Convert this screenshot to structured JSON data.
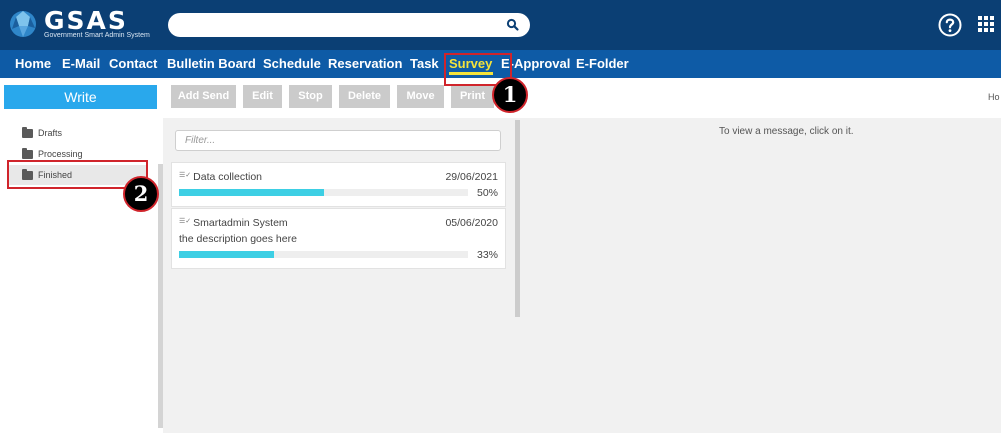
{
  "header": {
    "logo_text": "GSAS",
    "logo_subtitle": "Government Smart Admin System",
    "search_value": ""
  },
  "nav": {
    "items": [
      "Home",
      "E-Mail",
      "Contact",
      "Bulletin Board",
      "Schedule",
      "Reservation",
      "Task",
      "Survey",
      "E-Approval",
      "E-Folder"
    ],
    "active": "Survey"
  },
  "sidebar": {
    "write_label": "Write",
    "folders": [
      "Drafts",
      "Processing",
      "Finished"
    ],
    "selected": "Finished"
  },
  "toolbar": {
    "buttons": [
      "Add Send",
      "Edit",
      "Stop",
      "Delete",
      "Move",
      "Print"
    ],
    "breadcrumb": "Ho"
  },
  "list": {
    "filter_placeholder": "Filter...",
    "items": [
      {
        "title": "Data collection",
        "date": "29/06/2021",
        "description": "",
        "progress": 0.5,
        "progress_label": "50%"
      },
      {
        "title": "Smartadmin System",
        "date": "05/06/2020",
        "description": "the description goes here",
        "progress": 0.33,
        "progress_label": "33%"
      }
    ]
  },
  "viewer": {
    "empty_message": "To view a message, click on it."
  },
  "annotations": {
    "marker_1": "1",
    "marker_2": "2"
  },
  "colors": {
    "header_bg": "#0b3f74",
    "nav_bg": "#0e5ba6",
    "active_nav": "#f5e33b",
    "write_button": "#29a8ec",
    "progress_fill": "#3dcfe4",
    "annotation_red": "#d0242b"
  }
}
